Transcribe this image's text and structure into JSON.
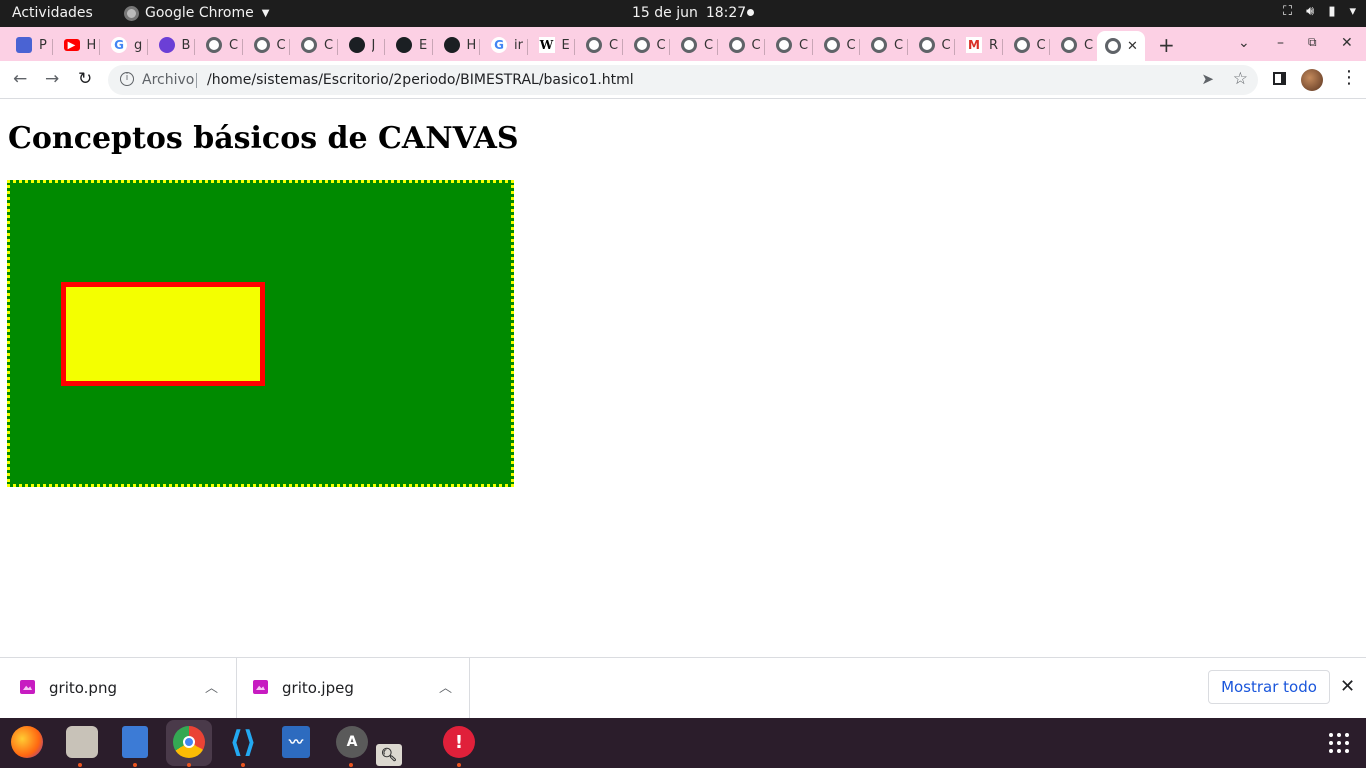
{
  "topbar": {
    "activities": "Actividades",
    "app_name": "Google Chrome",
    "date": "15 de jun",
    "time": "18:27"
  },
  "tabs": {
    "items": [
      {
        "icon": "contacts-icon",
        "label": "P"
      },
      {
        "icon": "youtube-icon",
        "label": "H"
      },
      {
        "icon": "google-icon",
        "label": "g"
      },
      {
        "icon": "canva-icon",
        "label": "B"
      },
      {
        "icon": "globe-icon",
        "label": "C"
      },
      {
        "icon": "globe-icon",
        "label": "C"
      },
      {
        "icon": "globe-icon",
        "label": "C"
      },
      {
        "icon": "github-icon",
        "label": "J"
      },
      {
        "icon": "github-icon",
        "label": "E"
      },
      {
        "icon": "github-icon",
        "label": "H"
      },
      {
        "icon": "google-icon",
        "label": "ir"
      },
      {
        "icon": "wikipedia-icon",
        "label": "E"
      },
      {
        "icon": "globe-icon",
        "label": "C"
      },
      {
        "icon": "globe-icon",
        "label": "C"
      },
      {
        "icon": "globe-icon",
        "label": "C"
      },
      {
        "icon": "globe-icon",
        "label": "C"
      },
      {
        "icon": "globe-icon",
        "label": "C"
      },
      {
        "icon": "globe-icon",
        "label": "C"
      },
      {
        "icon": "globe-icon",
        "label": "C"
      },
      {
        "icon": "globe-icon",
        "label": "C"
      },
      {
        "icon": "gmail-icon",
        "label": "R"
      },
      {
        "icon": "globe-icon",
        "label": "C"
      },
      {
        "icon": "globe-icon",
        "label": "C"
      }
    ],
    "active_icon": "globe-icon"
  },
  "omnibox": {
    "scheme_label": "Archivo",
    "url": "/home/sistemas/Escritorio/2periodo/BIMESTRAL/basico1.html"
  },
  "page": {
    "heading": "Conceptos básicos de CANVAS",
    "canvas_colors": {
      "background": "#008a00",
      "border": "#f4ff00",
      "rect_fill": "#f4ff00",
      "rect_stroke": "#ff0000"
    }
  },
  "downloads": {
    "items": [
      {
        "name": "grito.png"
      },
      {
        "name": "grito.jpeg"
      }
    ],
    "show_all": "Mostrar todo"
  },
  "dock": {
    "apps": [
      "firefox-icon",
      "files-icon",
      "text-editor-icon",
      "chrome-icon",
      "vscode-icon",
      "system-monitor-icon",
      "software-updater-icon",
      "screenshot-icon",
      "error-report-icon"
    ]
  }
}
